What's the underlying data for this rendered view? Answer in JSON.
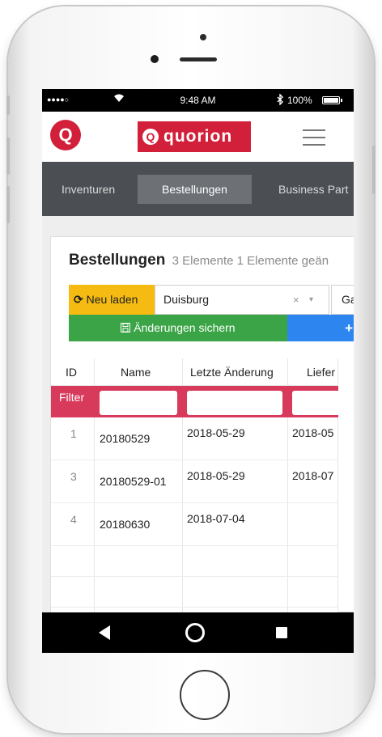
{
  "status_bar": {
    "signal": "●●●●○",
    "wifi_icon": "wifi-icon",
    "time": "9:48 AM",
    "bluetooth_icon": "bluetooth-icon",
    "battery": "100%",
    "battery_level": 1.0
  },
  "app_bar": {
    "logo_letter": "Q",
    "brand": "quorion",
    "menu_icon": "hamburger-menu-icon"
  },
  "nav": {
    "tabs": [
      {
        "label": "Inventuren",
        "active": false
      },
      {
        "label": "Bestellungen",
        "active": true
      },
      {
        "label": "Business Part",
        "active": false
      }
    ]
  },
  "panel": {
    "title": "Bestellungen",
    "subtitle": "3 Elemente 1 Elemente geän",
    "reload_label": "Neu laden",
    "reload_icon": "refresh-icon",
    "location_value": "Duisburg",
    "clear_symbol": "×",
    "caret_symbol": "▾",
    "second_select_value": "Ga",
    "save_label": "Änderungen sichern",
    "save_icon": "floppy-disk-icon",
    "add_symbol": "+",
    "colors": {
      "reload": "#f5bb13",
      "save": "#3aa446",
      "add": "#2d86f0",
      "filter": "#d83a5c",
      "brand": "#d3203a"
    }
  },
  "grid": {
    "columns": [
      "ID",
      "Name",
      "Letzte Änderung",
      "Liefer"
    ],
    "filter_label": "Filter",
    "rows": [
      {
        "id": "1",
        "name": "20180529",
        "changed": "2018-05-29",
        "delivery": "2018-05"
      },
      {
        "id": "3",
        "name": "20180529-01",
        "changed": "2018-05-29",
        "delivery": "2018-07"
      },
      {
        "id": "4",
        "name": "20180630",
        "changed": "2018-07-04",
        "delivery": ""
      }
    ]
  },
  "android_nav": {
    "back_icon": "back-triangle-icon",
    "home_icon": "home-circle-icon",
    "recent_icon": "recent-apps-square-icon"
  }
}
